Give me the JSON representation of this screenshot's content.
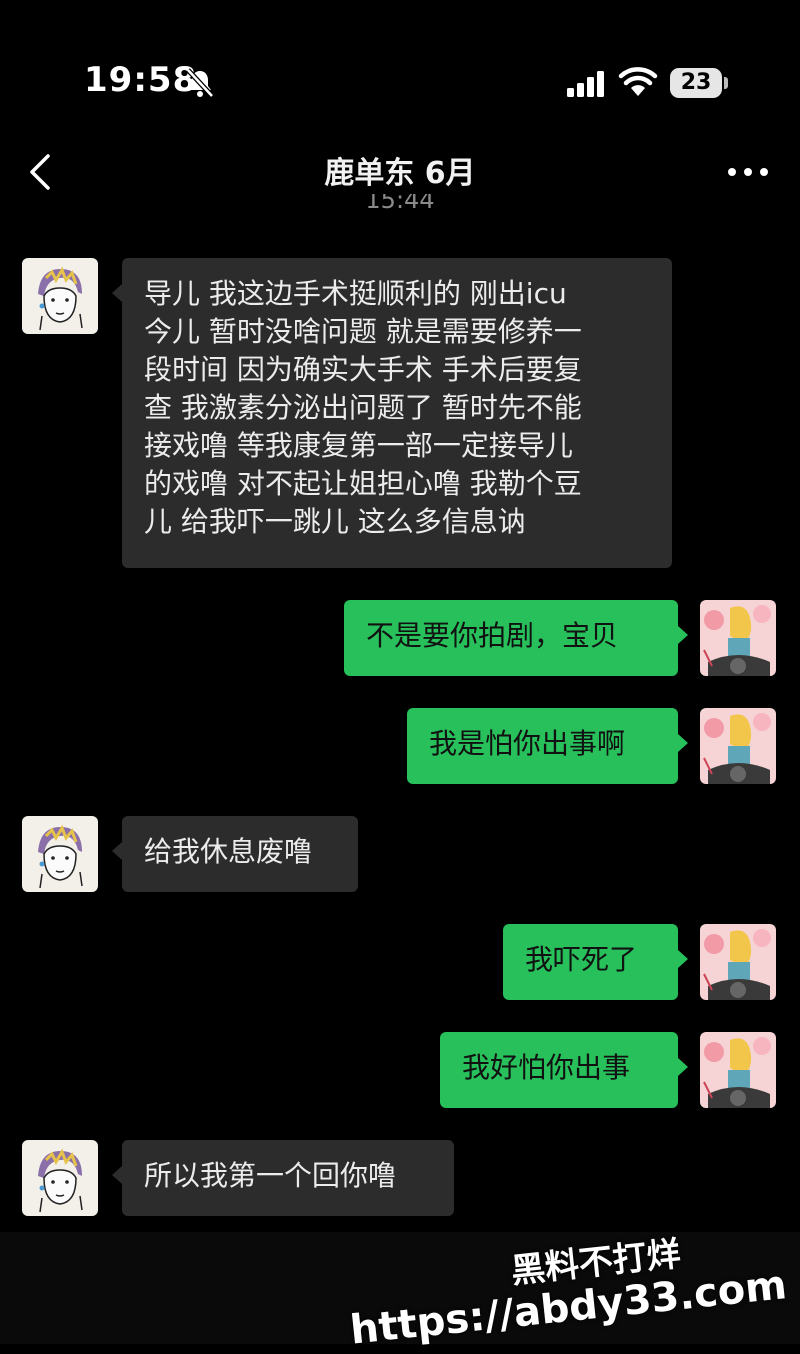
{
  "status_bar": {
    "time": "19:58",
    "battery": "23"
  },
  "nav": {
    "title": "鹿单东 6月"
  },
  "timestamp": "15:44",
  "messages": [
    {
      "side": "in",
      "text": "导儿 我这边手术挺顺利的 刚出icu\n今儿 暂时没啥问题 就是需要修养一\n段时间 因为确实大手术 手术后要复\n查 我激素分泌出问题了 暂时先不能\n接戏噜 等我康复第一部一定接导儿\n的戏噜 对不起让姐担心噜 我勒个豆\n儿 给我吓一跳儿 这么多信息讷"
    },
    {
      "side": "out",
      "text": "不是要你拍剧，宝贝"
    },
    {
      "side": "out",
      "text": "我是怕你出事啊"
    },
    {
      "side": "in",
      "text": "给我休息废噜"
    },
    {
      "side": "out",
      "text": "我吓死了"
    },
    {
      "side": "out",
      "text": "我好怕你出事"
    },
    {
      "side": "in",
      "text": "所以我第一个回你噜"
    }
  ],
  "watermark": {
    "line1": "黑料不打烊",
    "line2": "https://abdy33.com"
  },
  "colors": {
    "background": "#000000",
    "incoming_bubble": "#2c2c2c",
    "outgoing_bubble": "#27c05b"
  },
  "icons": [
    "bell-slash-icon",
    "signal-icon",
    "wifi-icon",
    "back-chevron-icon",
    "more-dots-icon"
  ]
}
